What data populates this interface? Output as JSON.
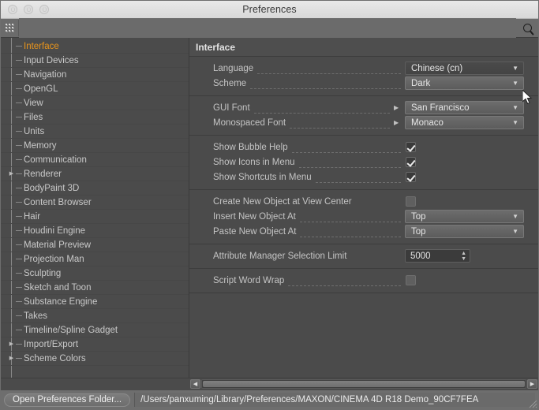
{
  "window": {
    "title": "Preferences",
    "traffic_lights": [
      "close",
      "minimize",
      "zoom"
    ]
  },
  "search": {
    "value": "",
    "placeholder": "",
    "icon": "search-icon",
    "grip_icon": "grip-dots-icon"
  },
  "sidebar": {
    "items": [
      {
        "label": "Interface",
        "selected": true,
        "expandable": false
      },
      {
        "label": "Input Devices",
        "selected": false,
        "expandable": false
      },
      {
        "label": "Navigation",
        "selected": false,
        "expandable": false
      },
      {
        "label": "OpenGL",
        "selected": false,
        "expandable": false
      },
      {
        "label": "View",
        "selected": false,
        "expandable": false
      },
      {
        "label": "Files",
        "selected": false,
        "expandable": false
      },
      {
        "label": "Units",
        "selected": false,
        "expandable": false
      },
      {
        "label": "Memory",
        "selected": false,
        "expandable": false
      },
      {
        "label": "Communication",
        "selected": false,
        "expandable": false
      },
      {
        "label": "Renderer",
        "selected": false,
        "expandable": true
      },
      {
        "label": "BodyPaint 3D",
        "selected": false,
        "expandable": false
      },
      {
        "label": "Content Browser",
        "selected": false,
        "expandable": false
      },
      {
        "label": "Hair",
        "selected": false,
        "expandable": false
      },
      {
        "label": "Houdini Engine",
        "selected": false,
        "expandable": false
      },
      {
        "label": "Material Preview",
        "selected": false,
        "expandable": false
      },
      {
        "label": "Projection Man",
        "selected": false,
        "expandable": false
      },
      {
        "label": "Sculpting",
        "selected": false,
        "expandable": false
      },
      {
        "label": "Sketch and Toon",
        "selected": false,
        "expandable": false
      },
      {
        "label": "Substance Engine",
        "selected": false,
        "expandable": false
      },
      {
        "label": "Takes",
        "selected": false,
        "expandable": false
      },
      {
        "label": "Timeline/Spline Gadget",
        "selected": false,
        "expandable": false
      },
      {
        "label": "Import/Export",
        "selected": false,
        "expandable": true
      },
      {
        "label": "Scheme Colors",
        "selected": false,
        "expandable": true
      }
    ]
  },
  "panel": {
    "title": "Interface",
    "groups": [
      {
        "rows": [
          {
            "type": "dropdown",
            "label": "Language",
            "value": "Chinese (cn)",
            "dotted": true,
            "submenu": false,
            "highlighted": true
          },
          {
            "type": "dropdown",
            "label": "Scheme",
            "value": "Dark",
            "dotted": true,
            "submenu": false,
            "highlighted": false
          }
        ]
      },
      {
        "rows": [
          {
            "type": "dropdown",
            "label": "GUI Font",
            "value": "San Francisco",
            "dotted": true,
            "submenu": true,
            "highlighted": false
          },
          {
            "type": "dropdown",
            "label": "Monospaced Font",
            "value": "Monaco",
            "dotted": true,
            "submenu": true,
            "highlighted": false
          }
        ]
      },
      {
        "rows": [
          {
            "type": "checkbox",
            "label": "Show Bubble Help",
            "checked": true,
            "dotted": true
          },
          {
            "type": "checkbox",
            "label": "Show Icons in Menu",
            "checked": true,
            "dotted": true
          },
          {
            "type": "checkbox",
            "label": "Show Shortcuts in Menu",
            "checked": true,
            "dotted": true
          }
        ]
      },
      {
        "rows": [
          {
            "type": "checkbox",
            "label": "Create New Object at View Center",
            "checked": false,
            "dotted": false
          },
          {
            "type": "dropdown",
            "label": "Insert New Object At",
            "value": "Top",
            "dotted": true,
            "submenu": false,
            "highlighted": false
          },
          {
            "type": "dropdown",
            "label": "Paste New Object At",
            "value": "Top",
            "dotted": true,
            "submenu": false,
            "highlighted": false
          }
        ]
      },
      {
        "rows": [
          {
            "type": "spinner",
            "label": "Attribute Manager Selection Limit",
            "value": "5000",
            "dotted": false
          }
        ]
      },
      {
        "rows": [
          {
            "type": "checkbox",
            "label": "Script Word Wrap",
            "checked": false,
            "dotted": true
          }
        ]
      }
    ]
  },
  "scrollbar": {
    "left_arrow": "◀",
    "right_arrow": "▶"
  },
  "footer": {
    "open_folder_label": "Open Preferences Folder...",
    "path": "/Users/panxuming/Library/Preferences/MAXON/CINEMA 4D R18 Demo_90CF7FEA"
  },
  "colors": {
    "highlight_red": "#f4665a",
    "selected_item": "#e8941c",
    "panel_bg": "#4b4b4b",
    "titlebar_bg": "#e3e3e3"
  }
}
